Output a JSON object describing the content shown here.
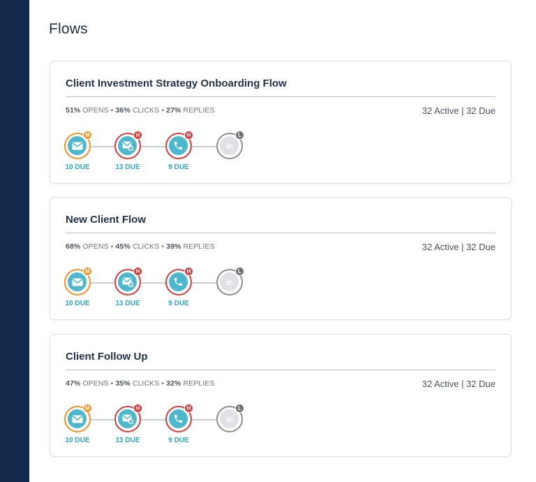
{
  "page": {
    "title": "Flows"
  },
  "colors": {
    "sidebar": "#12294b",
    "orange": "#f0932b",
    "red": "#d63c3c",
    "gray": "#8e8e8e",
    "teal": "#4db8cb",
    "due_text": "#2fa6c0"
  },
  "flows": [
    {
      "title": "Client Investment Strategy Onboarding Flow",
      "stats": {
        "opens_pct": "51%",
        "opens_label": "OPENS",
        "clicks_pct": "36%",
        "clicks_label": "CLICKS",
        "replies_pct": "27%",
        "replies_label": "REPLIES"
      },
      "summary": "32 Active | 32 Due",
      "steps": [
        {
          "icon": "mail-icon",
          "badge": "M",
          "due": "10 DUE"
        },
        {
          "icon": "mail-settings-icon",
          "badge": "H",
          "due": "13 DUE"
        },
        {
          "icon": "phone-icon",
          "badge": "H",
          "due": "9 DUE"
        },
        {
          "icon": "linkedin-icon",
          "badge": "L",
          "due": ""
        }
      ]
    },
    {
      "title": "New Client Flow",
      "stats": {
        "opens_pct": "68%",
        "opens_label": "OPENS",
        "clicks_pct": "45%",
        "clicks_label": "CLICKS",
        "replies_pct": "39%",
        "replies_label": "REPLIES"
      },
      "summary": "32 Active | 32 Due",
      "steps": [
        {
          "icon": "mail-icon",
          "badge": "M",
          "due": "10 DUE"
        },
        {
          "icon": "mail-settings-icon",
          "badge": "H",
          "due": "13 DUE"
        },
        {
          "icon": "phone-icon",
          "badge": "H",
          "due": "9 DUE"
        },
        {
          "icon": "linkedin-icon",
          "badge": "L",
          "due": ""
        }
      ]
    },
    {
      "title": "Client Follow Up",
      "stats": {
        "opens_pct": "47%",
        "opens_label": "OPENS",
        "clicks_pct": "35%",
        "clicks_label": "CLICKS",
        "replies_pct": "32%",
        "replies_label": "REPLIES"
      },
      "summary": "32 Active | 32 Due",
      "steps": [
        {
          "icon": "mail-icon",
          "badge": "M",
          "due": "10 DUE"
        },
        {
          "icon": "mail-settings-icon",
          "badge": "H",
          "due": "13 DUE"
        },
        {
          "icon": "phone-icon",
          "badge": "H",
          "due": "9 DUE"
        },
        {
          "icon": "linkedin-icon",
          "badge": "L",
          "due": ""
        }
      ]
    }
  ]
}
